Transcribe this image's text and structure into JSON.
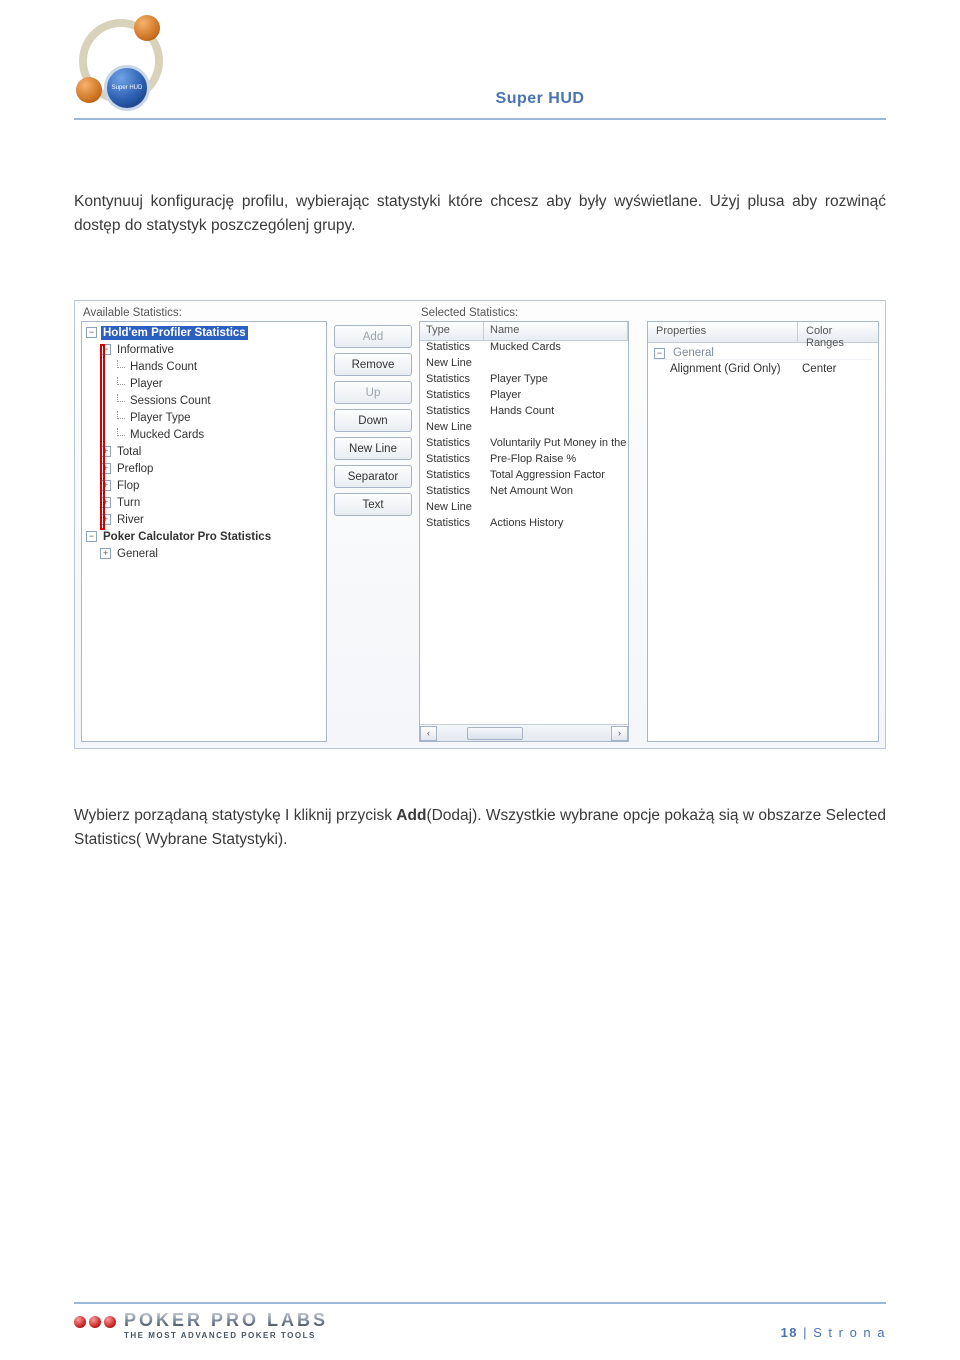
{
  "header": {
    "title": "Super HUD",
    "chip_text": "Super HUD"
  },
  "body": {
    "p1a": "Kontynuuj konfigurację profilu, wybierając statystyki które chcesz aby były wyświetlane. Użyj plusa aby rozwinąć dostęp do statystyk poszczególenj grupy.",
    "p2_pre": "Wybierz porządaną statystykę I kliknij przycisk ",
    "p2_bold": "Add",
    "p2_post": "(Dodaj). Wszystkie wybrane opcje pokażą sią w obszarze Selected Statistics( Wybrane Statystyki)."
  },
  "ui": {
    "available_label": "Available Statistics:",
    "selected_label": "Selected Statistics:",
    "tree": [
      {
        "level": 0,
        "exp": "-",
        "label": "Hold'em Profiler Statistics",
        "bold": true,
        "hl": true
      },
      {
        "level": 1,
        "exp": "-",
        "label": "Informative"
      },
      {
        "level": 2,
        "exp": "",
        "label": "Hands Count"
      },
      {
        "level": 2,
        "exp": "",
        "label": "Player"
      },
      {
        "level": 2,
        "exp": "",
        "label": "Sessions Count"
      },
      {
        "level": 2,
        "exp": "",
        "label": "Player Type"
      },
      {
        "level": 2,
        "exp": "",
        "label": "Mucked Cards"
      },
      {
        "level": 1,
        "exp": "+",
        "label": "Total"
      },
      {
        "level": 1,
        "exp": "+",
        "label": "Preflop"
      },
      {
        "level": 1,
        "exp": "+",
        "label": "Flop"
      },
      {
        "level": 1,
        "exp": "+",
        "label": "Turn"
      },
      {
        "level": 1,
        "exp": "+",
        "label": "River"
      },
      {
        "level": 0,
        "exp": "-",
        "label": "Poker Calculator Pro Statistics",
        "bold": true
      },
      {
        "level": 1,
        "exp": "+",
        "label": "General"
      }
    ],
    "buttons": {
      "add": "Add",
      "remove": "Remove",
      "up": "Up",
      "down": "Down",
      "newline": "New Line",
      "separator": "Separator",
      "text": "Text"
    },
    "selected_headers": {
      "type": "Type",
      "name": "Name"
    },
    "selected_rows": [
      {
        "type": "Statistics",
        "name": "Mucked Cards"
      },
      {
        "type": "New Line",
        "name": ""
      },
      {
        "type": "Statistics",
        "name": "Player Type"
      },
      {
        "type": "Statistics",
        "name": "Player"
      },
      {
        "type": "Statistics",
        "name": "Hands Count"
      },
      {
        "type": "New Line",
        "name": ""
      },
      {
        "type": "Statistics",
        "name": "Voluntarily Put Money in the"
      },
      {
        "type": "Statistics",
        "name": "Pre-Flop Raise %"
      },
      {
        "type": "Statistics",
        "name": "Total Aggression Factor"
      },
      {
        "type": "Statistics",
        "name": "Net Amount Won"
      },
      {
        "type": "New Line",
        "name": ""
      },
      {
        "type": "Statistics",
        "name": "Actions History"
      }
    ],
    "properties": {
      "headers": {
        "left": "Properties",
        "right": "Color Ranges"
      },
      "category": "General",
      "rows": [
        {
          "name": "Alignment (Grid Only)",
          "value": "Center"
        }
      ]
    }
  },
  "footer": {
    "brand": "POKER PRO LABS",
    "tagline": "THE MOST ADVANCED POKER TOOLS",
    "page_num": "18",
    "page_label": " | S t r o n a"
  }
}
